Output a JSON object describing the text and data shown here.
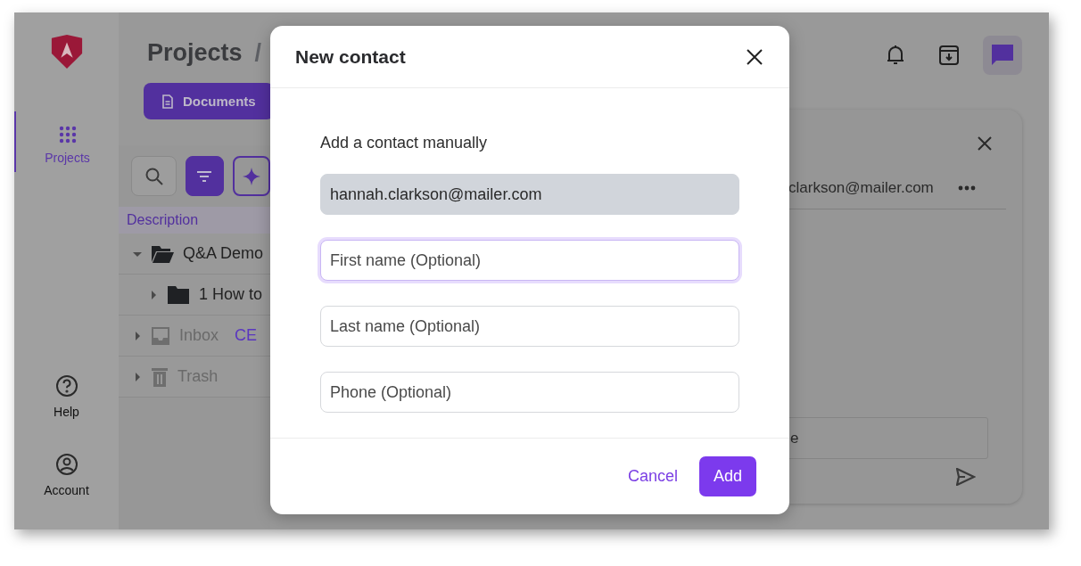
{
  "sidebar": {
    "items": [
      {
        "label": "Projects",
        "kind": "grid",
        "selected": true
      }
    ],
    "bottom_items": [
      {
        "label": "Help",
        "kind": "help"
      },
      {
        "label": "Account",
        "kind": "account"
      }
    ]
  },
  "header": {
    "title": "Projects",
    "separator": "/",
    "tabs": [
      {
        "label": "Documents",
        "selected": true
      }
    ]
  },
  "toolbar": {
    "buttons": [
      {
        "kind": "search",
        "active": false
      },
      {
        "kind": "filter",
        "active": true
      },
      {
        "kind": "sparkle",
        "active": false
      }
    ]
  },
  "table": {
    "columns": [
      "Description"
    ],
    "rows": [
      {
        "name": "Q&A Demo",
        "kind": "folder-open",
        "expanded": true,
        "dimmed": false,
        "children": [
          {
            "name": "1 How to",
            "kind": "folder",
            "expanded": false,
            "dimmed": false
          }
        ]
      },
      {
        "name": "Inbox",
        "kind": "inbox",
        "expanded": false,
        "dimmed": true,
        "tag": "CE"
      },
      {
        "name": "Trash",
        "kind": "trash",
        "expanded": false,
        "dimmed": true
      }
    ]
  },
  "top_icons": [
    {
      "kind": "bell",
      "selected": false
    },
    {
      "kind": "download",
      "selected": false
    },
    {
      "kind": "chat",
      "selected": true
    }
  ],
  "chat_panel": {
    "contact": "clarkson@mailer.com",
    "message_field": {
      "value": "e"
    }
  },
  "dialog": {
    "title": "New contact",
    "subtitle": "Add a contact manually",
    "fields": [
      {
        "value": "hannah.clarkson@mailer.com",
        "disabled": true,
        "focused": false
      },
      {
        "placeholder": "First name (Optional)",
        "disabled": false,
        "focused": true
      },
      {
        "placeholder": "Last name (Optional)",
        "disabled": false,
        "focused": false
      },
      {
        "placeholder": "Phone (Optional)",
        "disabled": false,
        "focused": false
      }
    ],
    "buttons": [
      {
        "label": "Cancel",
        "kind": "text"
      },
      {
        "label": "Add",
        "kind": "primary"
      }
    ]
  }
}
